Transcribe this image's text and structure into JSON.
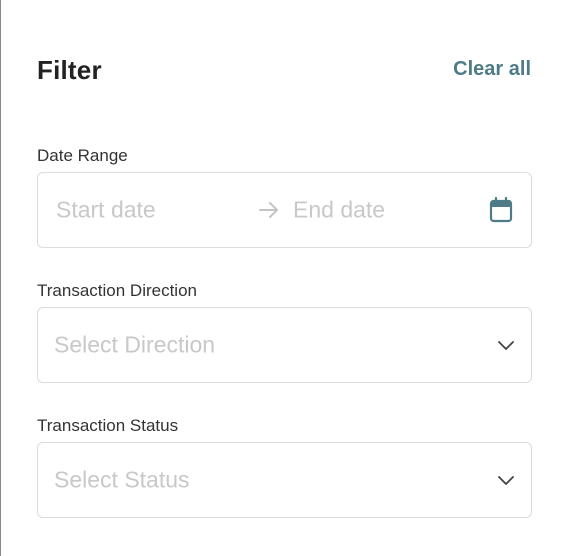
{
  "filter": {
    "title": "Filter",
    "clear_all_label": "Clear all"
  },
  "date_range": {
    "label": "Date Range",
    "start_placeholder": "Start date",
    "end_placeholder": "End date"
  },
  "transaction_direction": {
    "label": "Transaction Direction",
    "placeholder": "Select Direction"
  },
  "transaction_status": {
    "label": "Transaction Status",
    "placeholder": "Select Status"
  },
  "colors": {
    "accent": "#4e7b86",
    "title": "#222222",
    "label": "#333333",
    "placeholder": "#c8c8c8",
    "border": "#dcdcdc"
  },
  "icons": {
    "arrow": "arrow-right-icon",
    "calendar": "calendar-icon",
    "chevron": "chevron-down-icon"
  }
}
